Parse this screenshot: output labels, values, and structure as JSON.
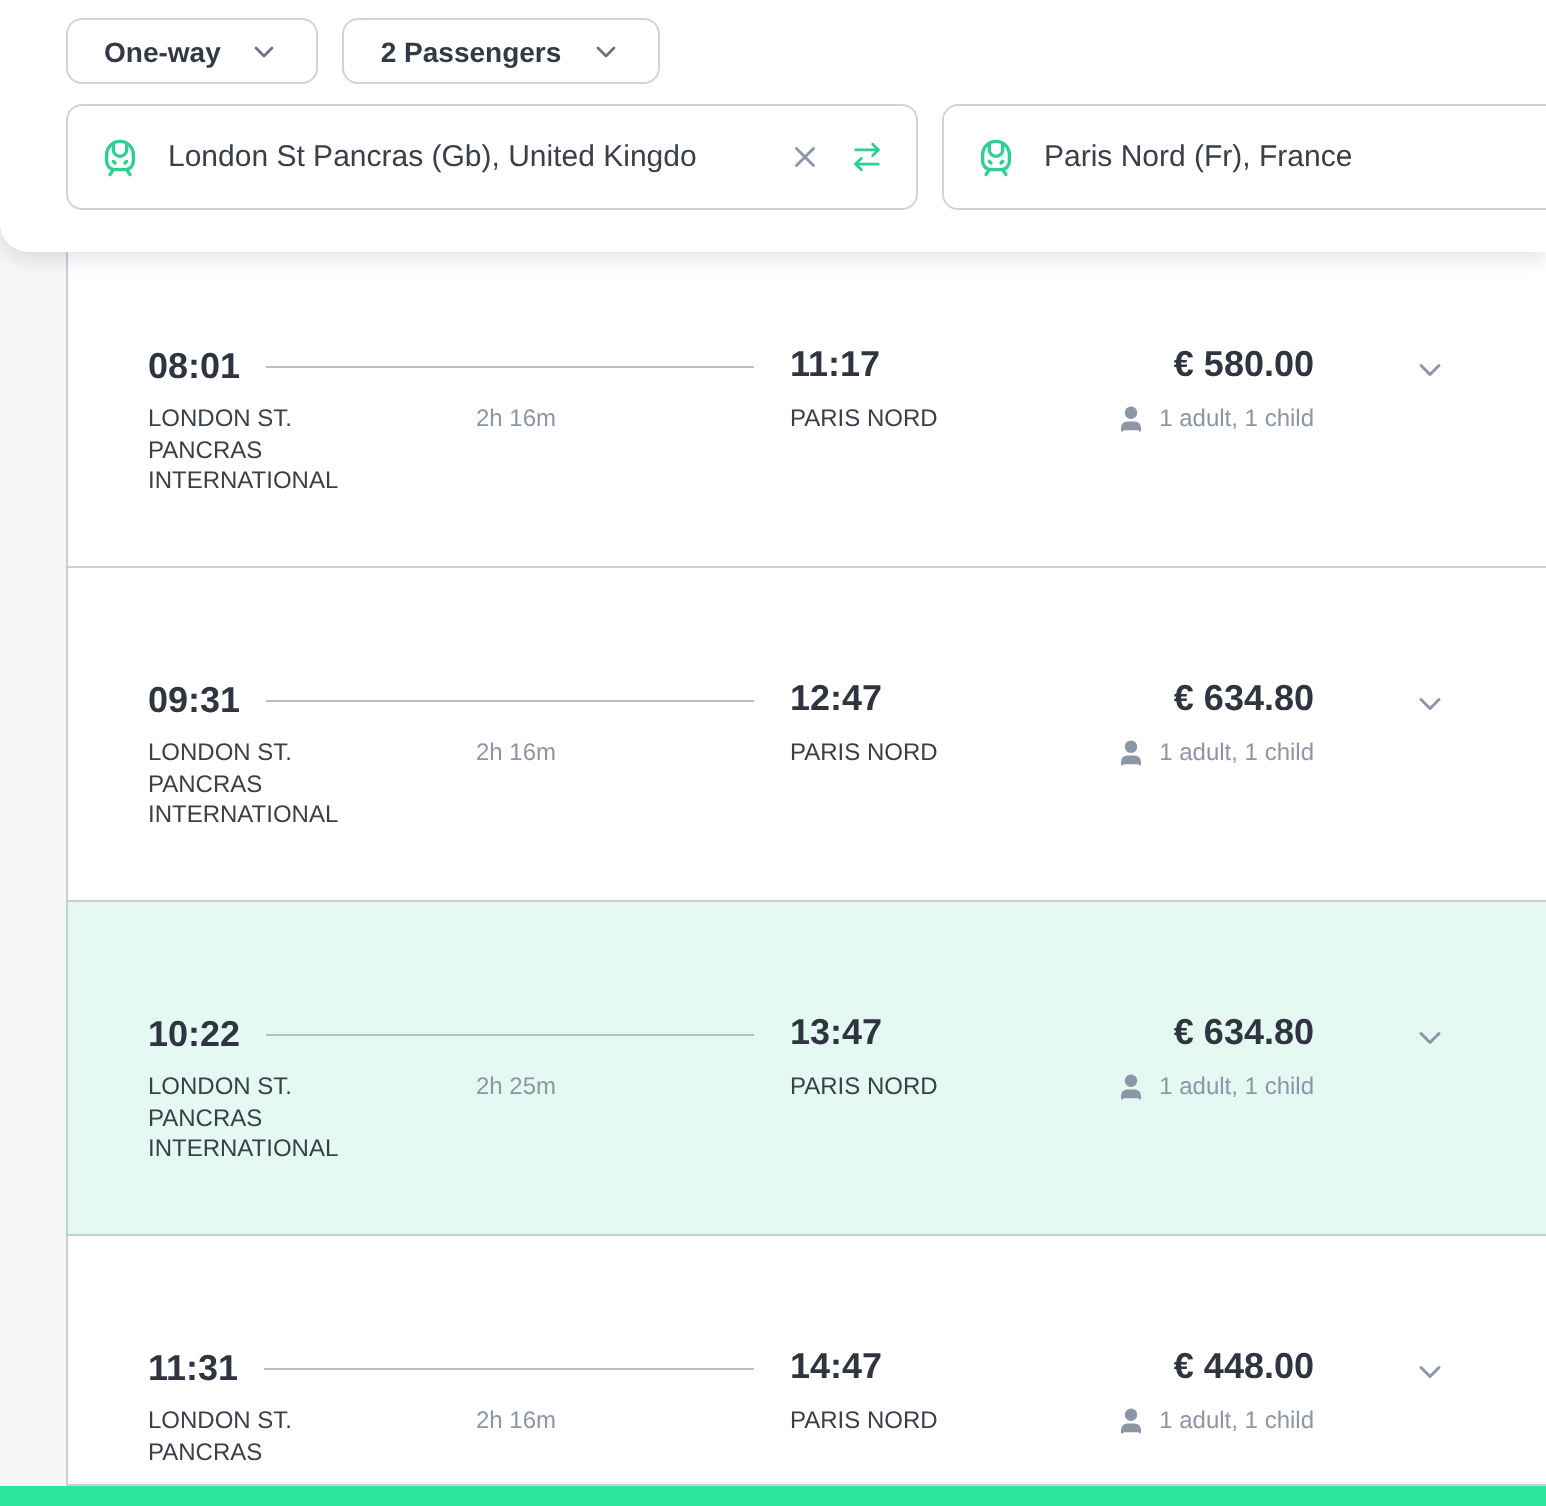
{
  "search": {
    "trip_type": "One-way",
    "passengers": "2 Passengers",
    "origin": "London St Pancras (Gb), United Kingdo",
    "destination": "Paris Nord (Fr), France"
  },
  "results": [
    {
      "departure_time": "08:01",
      "departure_station": "LONDON ST. PANCRAS INTERNATIONAL",
      "duration": "2h 16m",
      "arrival_time": "11:17",
      "arrival_station": "PARIS NORD",
      "price": "€ 580.00",
      "travellers": "1 adult, 1 child",
      "selected": false
    },
    {
      "departure_time": "09:31",
      "departure_station": "LONDON ST. PANCRAS INTERNATIONAL",
      "duration": "2h 16m",
      "arrival_time": "12:47",
      "arrival_station": "PARIS NORD",
      "price": "€ 634.80",
      "travellers": "1 adult, 1 child",
      "selected": false
    },
    {
      "departure_time": "10:22",
      "departure_station": "LONDON ST. PANCRAS INTERNATIONAL",
      "duration": "2h 25m",
      "arrival_time": "13:47",
      "arrival_station": "PARIS NORD",
      "price": "€ 634.80",
      "travellers": "1 adult, 1 child",
      "selected": true
    },
    {
      "departure_time": "11:31",
      "departure_station": "LONDON ST. PANCRAS",
      "duration": "2h 16m",
      "arrival_time": "14:47",
      "arrival_station": "PARIS NORD",
      "price": "€ 448.00",
      "travellers": "1 adult, 1 child",
      "selected": false
    }
  ]
}
